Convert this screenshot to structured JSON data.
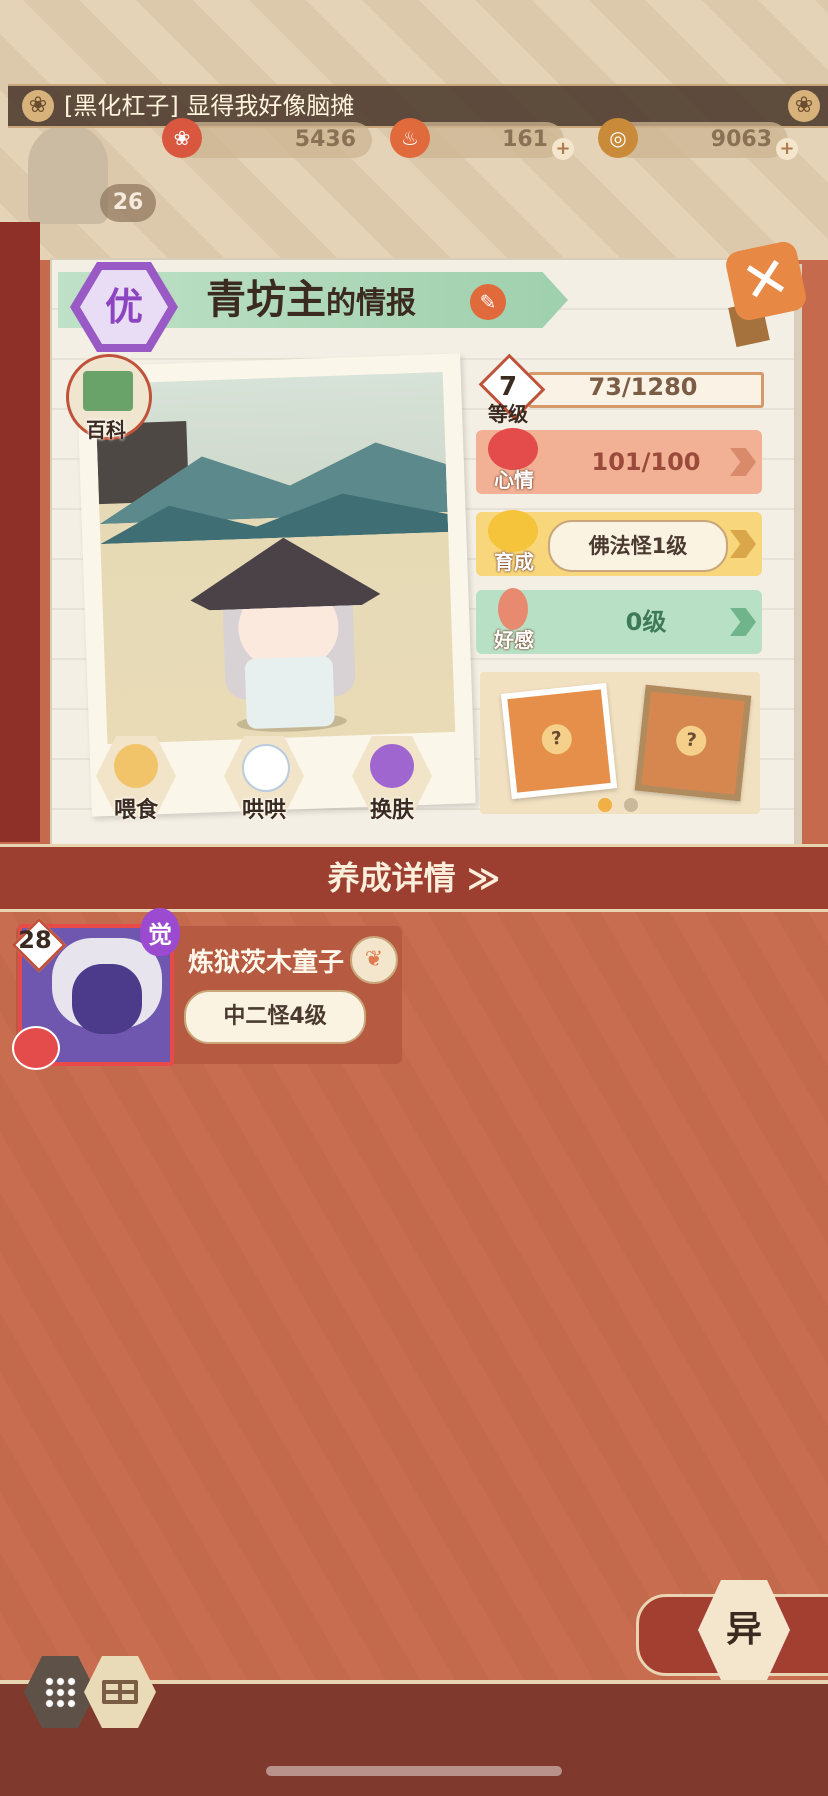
{
  "ticker": {
    "text": "[黑化杠子] 显得我好像脑摊",
    "flower": "❀"
  },
  "resources": [
    {
      "name": "mood-token",
      "value": "5436",
      "icon": "❀",
      "color": "#d9573e"
    },
    {
      "name": "spirit",
      "value": "161",
      "icon": "♨",
      "color": "#e06a3c"
    },
    {
      "name": "coin",
      "value": "9063",
      "icon": "◎",
      "color": "#c98a3a"
    }
  ],
  "player": {
    "level": "26"
  },
  "monster": {
    "rank": "优",
    "name": "青坊主",
    "name_suffix": "的情报",
    "level": "7",
    "level_label": "等级",
    "exp": "73/1280",
    "mood_label": "心情",
    "mood": "101/100",
    "growth_label": "育成",
    "growth": "佛法怪1级",
    "favor_label": "好感",
    "favor": "0级"
  },
  "wiki": {
    "label": "百科"
  },
  "actions": [
    {
      "label": "喂食",
      "color": "#f2c46a"
    },
    {
      "label": "哄哄",
      "color": "#ffffff"
    },
    {
      "label": "换肤",
      "color": "#a066d0"
    }
  ],
  "section": {
    "title": "养成详情 ≫"
  },
  "entry": {
    "level": "28",
    "awake": "觉",
    "name": "炼狱茨木童子",
    "tier": "中二怪4级"
  },
  "buttons": {
    "yi": "异"
  },
  "colors": {
    "mood_bg": "#f2b094",
    "growth_bg": "#f8d67c",
    "favor_bg": "#b8e0c4",
    "mood_text": "#9a4a3a",
    "favor_text": "#3e7a56",
    "dot_active": "#f0b043",
    "dot_inactive": "#c9b89a"
  }
}
